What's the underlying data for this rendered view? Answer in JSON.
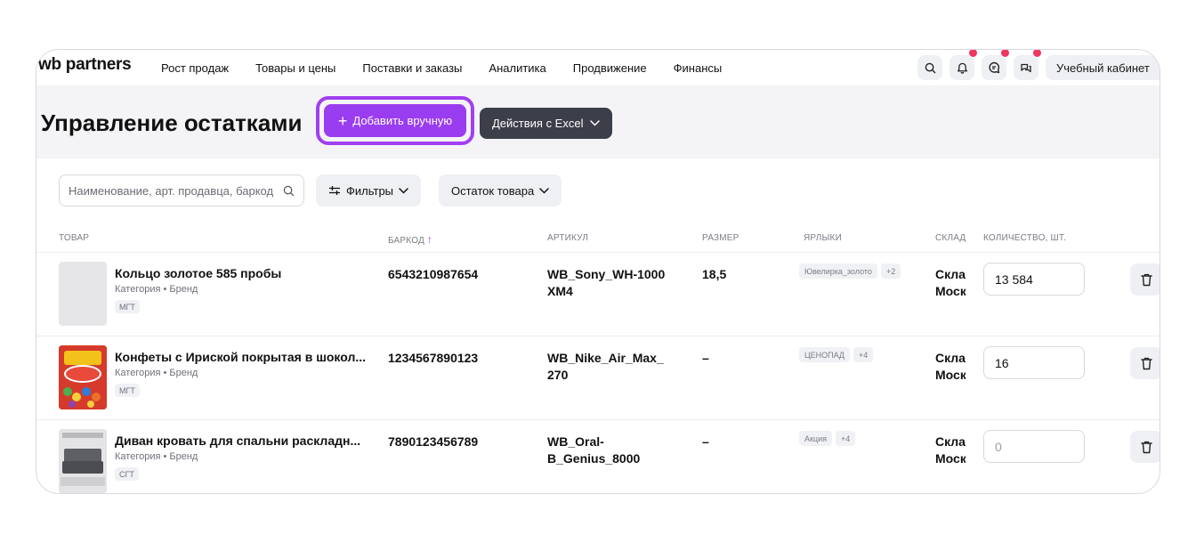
{
  "nav": {
    "logo": "wb partners",
    "links": [
      "Рост продаж",
      "Товары и цены",
      "Поставки и заказы",
      "Аналитика",
      "Продвижение",
      "Финансы"
    ],
    "cabinet": "Учебный кабинет"
  },
  "header": {
    "title": "Управление остатками",
    "add_button": "Добавить вручную",
    "excel_button": "Действия с Excel"
  },
  "toolbar": {
    "search_placeholder": "Наименование, арт. продавца, баркод",
    "filters_button": "Фильтры",
    "stock_button": "Остаток товара"
  },
  "table": {
    "headers": {
      "product": "ТОВАР",
      "barcode": "БАРКОД",
      "article": "АРТИКУЛ",
      "size": "РАЗМЕР",
      "labels": "ЯРЛЫКИ",
      "warehouse": "СКЛАД",
      "quantity": "КОЛИЧЕСТВО, ШТ."
    },
    "rows": [
      {
        "name": "Кольцо золотое 585 пробы",
        "category": "Категория • Бренд",
        "tag": "МГТ",
        "barcode": "6543210987654",
        "article_line1": "WB_Sony_WH-1000",
        "article_line2": "XM4",
        "size": "18,5",
        "label1": "Ювелирка_золото",
        "label2": "+2",
        "warehouse_line1": "Склад",
        "warehouse_line2": "Москва",
        "quantity": "13 584"
      },
      {
        "name": "Конфеты с Ириской покрытая в шокол...",
        "category": "Категория • Бренд",
        "tag": "МГТ",
        "barcode": "1234567890123",
        "article_line1": "WB_Nike_Air_Max_",
        "article_line2": "270",
        "size": "–",
        "label1": "ЦЕНОПАД",
        "label2": "+4",
        "warehouse_line1": "Склад",
        "warehouse_line2": "Москва",
        "quantity": "16"
      },
      {
        "name": "Диван кровать для спальни раскладн...",
        "category": "Категория • Бренд",
        "tag": "СГТ",
        "barcode": "7890123456789",
        "article_line1": "WB_Oral-",
        "article_line2": "B_Genius_8000",
        "size": "–",
        "label1": "Акция",
        "label2": "+4",
        "warehouse_line1": "Склад",
        "warehouse_line2": "Москва",
        "quantity_placeholder": "0"
      }
    ]
  },
  "colors": {
    "accent": "#9a3cf0",
    "dark_button": "#3c3e4a",
    "badge": "#f0365f"
  }
}
